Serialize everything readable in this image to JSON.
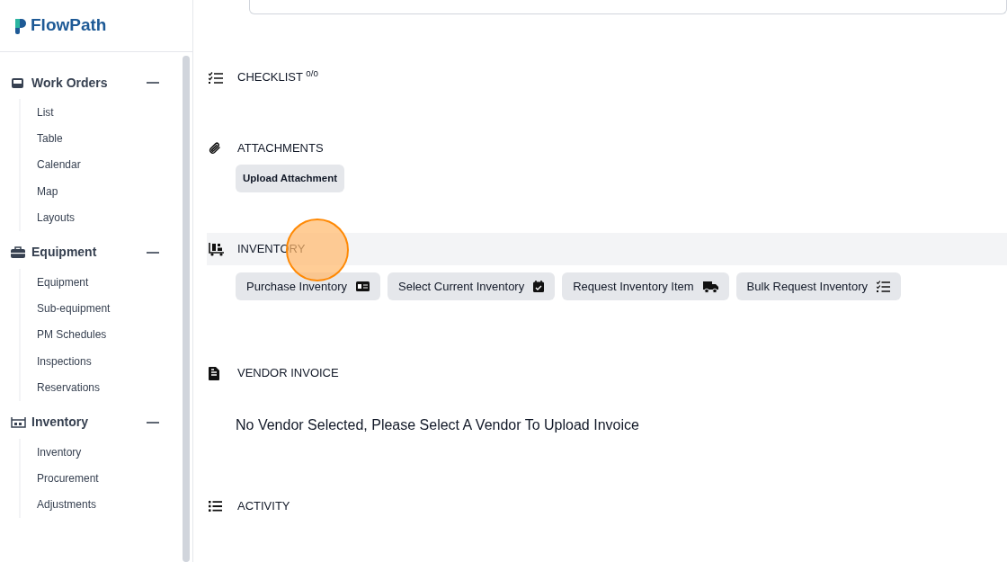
{
  "brand": {
    "name": "FlowPath"
  },
  "sidebar": {
    "groups": [
      {
        "label": "Work Orders",
        "expanded": true,
        "items": [
          {
            "label": "List"
          },
          {
            "label": "Table"
          },
          {
            "label": "Calendar"
          },
          {
            "label": "Map"
          },
          {
            "label": "Layouts"
          }
        ]
      },
      {
        "label": "Equipment",
        "expanded": true,
        "items": [
          {
            "label": "Equipment"
          },
          {
            "label": "Sub-equipment"
          },
          {
            "label": "PM Schedules"
          },
          {
            "label": "Inspections"
          },
          {
            "label": "Reservations"
          }
        ]
      },
      {
        "label": "Inventory",
        "expanded": true,
        "items": [
          {
            "label": "Inventory"
          },
          {
            "label": "Procurement"
          },
          {
            "label": "Adjustments"
          }
        ]
      }
    ]
  },
  "sections": [
    {
      "kind": "checklist",
      "title": "CHECKLIST $^{0/0}$",
      "highlighted": false
    },
    {
      "kind": "attachments",
      "title": "ATTACHMENTS",
      "highlighted": false,
      "buttons": [
        {
          "label": "Upload Attachment"
        }
      ]
    },
    {
      "kind": "inventory",
      "title": "INVENTORY",
      "highlighted": true,
      "buttons": [
        {
          "label": "Purchase Inventory"
        },
        {
          "label": "Select Current Inventory"
        },
        {
          "label": "Request Inventory Item"
        },
        {
          "label": "Bulk Request Inventory"
        }
      ]
    },
    {
      "kind": "vendor_invoice",
      "title": "VENDOR INVOICE",
      "highlighted": false,
      "message": "No Vendor Selected, Please Select A Vendor To Upload Invoice"
    },
    {
      "kind": "activity",
      "title": "ACTIVITY",
      "highlighted": false
    }
  ]
}
